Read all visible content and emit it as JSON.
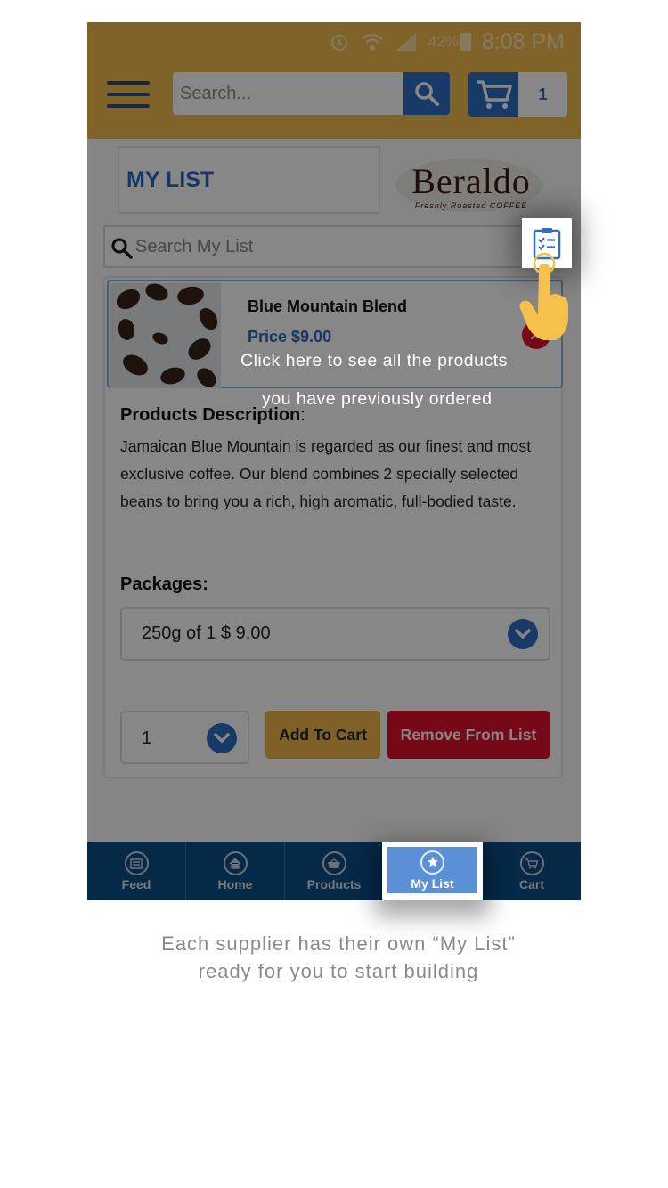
{
  "status_bar": {
    "battery": "42%",
    "time": "8:08 PM"
  },
  "header": {
    "search_placeholder": "Search...",
    "cart_count": "1"
  },
  "page": {
    "title": "MY LIST",
    "brand_name": "Beraldo",
    "brand_tagline": "Freshly Roasted COFFEE"
  },
  "list_search": {
    "placeholder": "Search My List"
  },
  "product": {
    "name": "Blue Mountain Blend",
    "price": "Price $9.00",
    "description_title": "Products Description",
    "description_colon": ":",
    "description": "Jamaican Blue Mountain is regarded as our finest and most exclusive coffee. Our blend combines 2 specially selected beans to bring you a rich, high aromatic, full-bodied taste.",
    "packages_label": "Packages:",
    "package_selected": "250g of 1 $ 9.00",
    "quantity": "1",
    "add_to_cart": "Add To Cart",
    "remove_from_list": "Remove From List"
  },
  "nav": [
    {
      "label": "Feed",
      "icon": "feed-icon"
    },
    {
      "label": "Home",
      "icon": "home-icon"
    },
    {
      "label": "Products",
      "icon": "basket-icon"
    },
    {
      "label": "My List",
      "icon": "star-icon"
    },
    {
      "label": "Cart",
      "icon": "cart-icon"
    }
  ],
  "tooltip": {
    "line1": "Click here to see all the products",
    "line2": "you have previously ordered"
  },
  "caption": {
    "line1": "Each supplier has their own “My List”",
    "line2": "ready for you to start building"
  },
  "colors": {
    "header": "#f1bb4f",
    "accent": "#2f6fc1",
    "danger": "#e0102c",
    "nav": "#0a4f86"
  }
}
